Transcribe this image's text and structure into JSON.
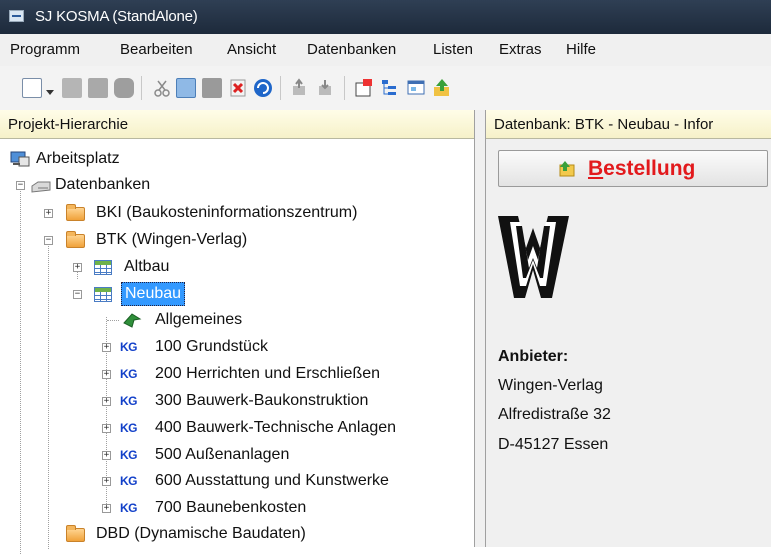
{
  "window": {
    "title": "SJ KOSMA (StandAlone)"
  },
  "menu": [
    "Programm",
    "Bearbeiten",
    "Ansicht",
    "Datenbanken",
    "Listen",
    "Extras",
    "Hilfe"
  ],
  "left_pane": {
    "header": "Projekt-Hierarchie"
  },
  "tree": {
    "root": "Arbeitsplatz",
    "databases": "Datenbanken",
    "bki": "BKI (Baukosteninformationszentrum)",
    "btk": "BTK (Wingen-Verlag)",
    "altbau": "Altbau",
    "neubau": "Neubau",
    "allgemeines": "Allgemeines",
    "kg_badge": "KG",
    "kg_items": [
      "100 Grundstück",
      "200 Herrichten und Erschließen",
      "300 Bauwerk-Baukonstruktion",
      "400 Bauwerk-Technische Anlagen",
      "500 Außenanlagen",
      "600 Ausstattung und Kunstwerke",
      "700 Baunebenkosten"
    ],
    "dbd": "DBD (Dynamische Baudaten)"
  },
  "right_pane": {
    "header": "Datenbank: BTK - Neubau - Infor",
    "order_button": "Bestellung",
    "provider_label": "Anbieter:",
    "provider_name": "Wingen-Verlag",
    "provider_street": "Alfredistraße 32",
    "provider_city": "D-45127 Essen"
  },
  "colors": {
    "selection": "#3399ff",
    "order_text": "#e2191c",
    "kg_badge": "#1240c9",
    "header_bg": "#fffde8"
  }
}
